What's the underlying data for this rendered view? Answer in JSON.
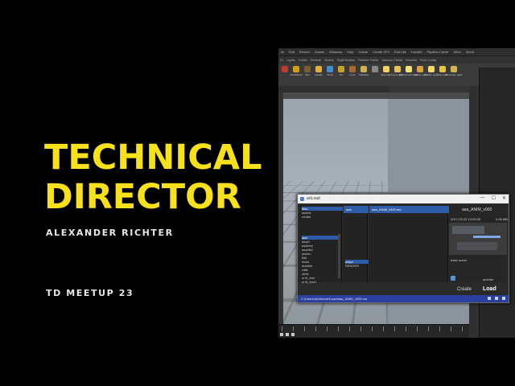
{
  "slide": {
    "title_line1": "TECHNICAL",
    "title_line2": "DIRECTOR",
    "author": "ALEXANDER RICHTER",
    "event": "TD MEETUP 23",
    "title_color": "#f7e11a",
    "background": "#000000"
  },
  "houdini": {
    "menu": [
      "ile",
      "Edit",
      "Render",
      "Assets",
      "Windows",
      "Help",
      "Cache",
      "Create VFX",
      "Edit Utis",
      "Houdini",
      "Pipeline Cache",
      "3Dev",
      "3Dvid"
    ],
    "shelf_tabs": [
      "Cr",
      "Lights",
      "Collisi",
      "Particle",
      "Grains",
      "Rigid Bodies",
      "Particle Fluids",
      "Viscous Fluids",
      "Oceans",
      "Fluid Conta"
    ],
    "shelf_tools": [
      "",
      "Hair/Effects",
      "Teer",
      "Handle",
      "Fluids",
      "Fur",
      "rman",
      "rDarkDay",
      "",
      "Spot Light",
      "Area Light",
      "Environment Light",
      "Volume Light",
      "Distant Light",
      "Sky Light",
      "Geometry Light"
    ],
    "viewport_menus": [
      "Persp",
      "No cam"
    ],
    "right_panel_tabs": [
      "Parameters",
      "Take List"
    ]
  },
  "dialog": {
    "title": "ariLoad",
    "window_buttons": [
      "—",
      "☐",
      "✕"
    ],
    "projects": [
      "lib/u",
      "assets",
      "render"
    ],
    "assets": [
      "aaa",
      "asset",
      "assbest",
      "assetkit",
      "asslev",
      "flail",
      "dead",
      "dutable",
      "rdfls",
      "cfree",
      "ut lit_test",
      "ut lit_test1",
      "load11",
      "leer"
    ],
    "tasks_header": "aaa",
    "tasks": [
      "script",
      "RENDER"
    ],
    "files_header": "aaa_ANIM_v000.ma",
    "preview_name": "aaa_ANIM_v000",
    "preview_date": "2017-03-22  13:03:49",
    "preview_size": "0.06 MB",
    "preview_scene": "base scene",
    "user": "arichter",
    "create_label": "Create",
    "load_label": "Load",
    "path": "C:/Users/arichter/ariLoad/aaa_ANIM_v000.ma"
  }
}
